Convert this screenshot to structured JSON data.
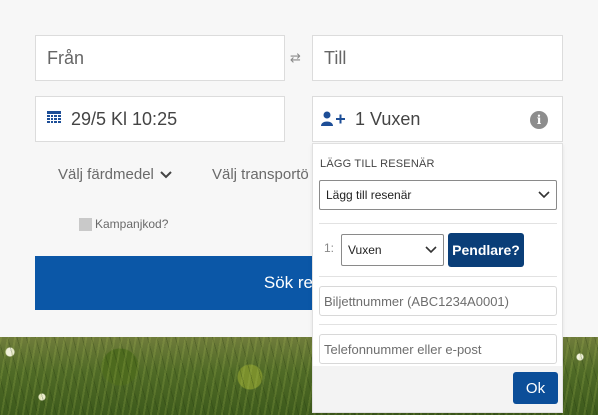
{
  "search_form": {
    "from_placeholder": "Från",
    "to_placeholder": "Till",
    "date_value": "29/5 Kl 10:25",
    "passengers_value": "1 Vuxen",
    "mode_label": "Välj färdmedel",
    "transport_label": "Välj transportö",
    "campaign_label": "Kampanjkod?",
    "search_label": "Sök re"
  },
  "passenger_popup": {
    "title": "LÄGG TILL RESENÄR",
    "add_select_value": "Lägg till resenär",
    "rows": [
      {
        "index": "1:",
        "type_value": "Vuxen",
        "commuter_label": "Pendlare?"
      }
    ],
    "ticket_placeholder": "Biljettnummer (ABC1234A0001)",
    "contact_placeholder": "Telefonnummer eller e-post",
    "ok_label": "Ok"
  },
  "colors": {
    "primary": "#0b57a7",
    "dark_primary": "#0a3e78",
    "icon_blue": "#1d4e97"
  },
  "icons": [
    "swap-icon",
    "calendar-icon",
    "add-person-icon",
    "info-icon",
    "chevron-down-icon"
  ]
}
